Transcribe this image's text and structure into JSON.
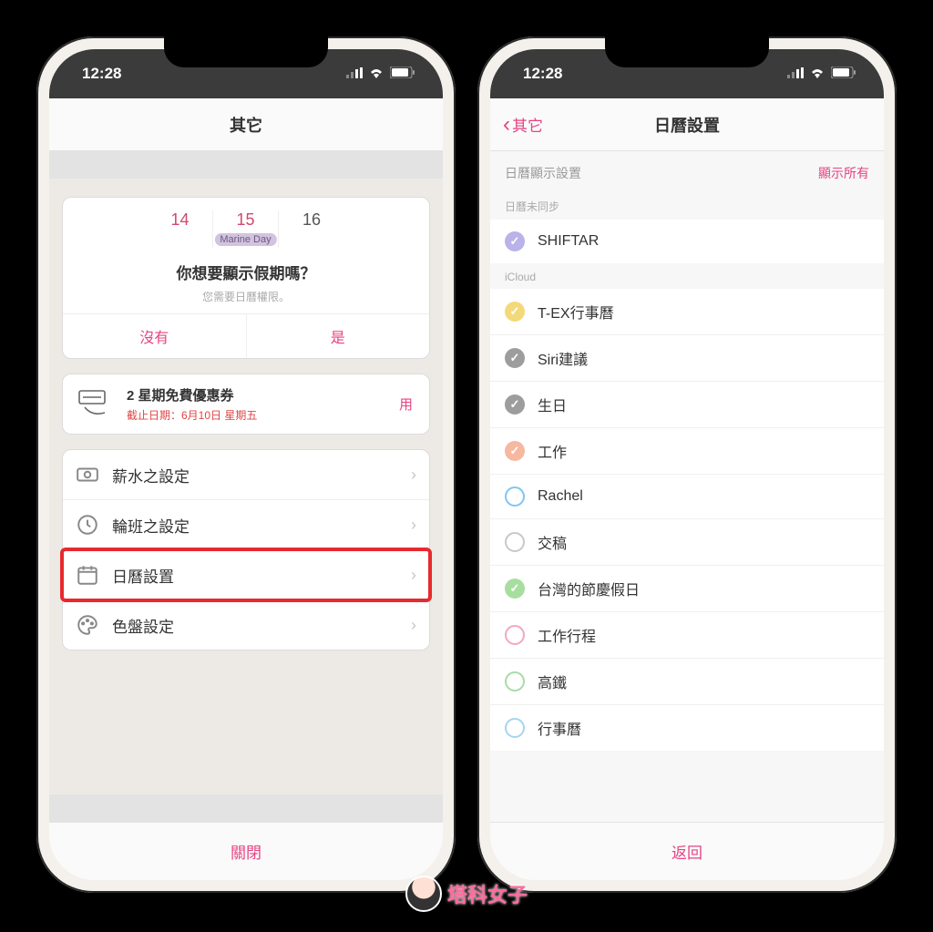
{
  "status": {
    "time": "12:28"
  },
  "colors": {
    "accent": "#e74383"
  },
  "screen1": {
    "nav_title": "其它",
    "holiday": {
      "dates": [
        "14",
        "15",
        "16"
      ],
      "event_label": "Marine Day",
      "question": "你想要顯示假期嗎？",
      "subtext": "您需要日曆權限。",
      "no": "沒有",
      "yes": "是"
    },
    "coupon": {
      "title": "2 星期免費優惠券",
      "deadline": "截止日期：6月10日 星期五",
      "use": "用"
    },
    "rows": {
      "salary": "薪水之設定",
      "shift": "輪班之設定",
      "calendar": "日曆設置",
      "palette": "色盤設定"
    },
    "footer": "關閉"
  },
  "screen2": {
    "back_label": "其它",
    "nav_title": "日曆設置",
    "section_title": "日曆顯示設置",
    "show_all": "顯示所有",
    "group_unsynced": "日曆未同步",
    "group_icloud": "iCloud",
    "unsynced": [
      {
        "name": "SHIFTAR",
        "color": "#b9b3e8",
        "filled": true,
        "checked": true
      }
    ],
    "icloud": [
      {
        "name": "T-EX行事曆",
        "color": "#f3d97a",
        "filled": true,
        "checked": true
      },
      {
        "name": "Siri建議",
        "color": "#9d9d9d",
        "filled": true,
        "checked": true
      },
      {
        "name": "生日",
        "color": "#9d9d9d",
        "filled": true,
        "checked": true
      },
      {
        "name": "工作",
        "color": "#f6b8a0",
        "filled": true,
        "checked": true
      },
      {
        "name": "Rachel",
        "color": "#7fc6ef",
        "filled": false,
        "checked": false
      },
      {
        "name": "交稿",
        "color": "#c8c8c8",
        "filled": false,
        "checked": false
      },
      {
        "name": "台灣的節慶假日",
        "color": "#a7de9f",
        "filled": true,
        "checked": true
      },
      {
        "name": "工作行程",
        "color": "#f3a6c4",
        "filled": false,
        "checked": false
      },
      {
        "name": "高鐵",
        "color": "#a6dca6",
        "filled": false,
        "checked": false
      },
      {
        "name": "行事曆",
        "color": "#a7d5ef",
        "filled": false,
        "checked": false
      }
    ],
    "footer": "返回"
  },
  "watermark": "塔科女子"
}
